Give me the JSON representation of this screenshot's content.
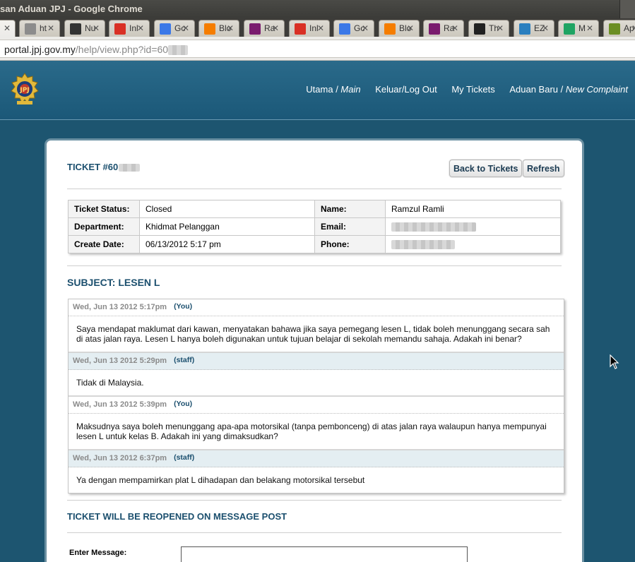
{
  "window": {
    "title": "san Aduan JPJ - Google Chrome"
  },
  "tabs": [
    {
      "label": "ht",
      "icon": "globe-icon",
      "color": "#8c8c8c"
    },
    {
      "label": "Nu",
      "icon": "github-icon",
      "color": "#333333"
    },
    {
      "label": "Inl",
      "icon": "gmail-icon",
      "color": "#d93025"
    },
    {
      "label": "Gc",
      "icon": "google-reader-icon",
      "color": "#3b78e7"
    },
    {
      "label": "Blo",
      "icon": "blogger-icon",
      "color": "#f57d00"
    },
    {
      "label": "Ra",
      "icon": "ra-icon",
      "color": "#7a1b6e"
    },
    {
      "label": "Inl",
      "icon": "gmail-icon",
      "color": "#d93025"
    },
    {
      "label": "Gc",
      "icon": "google-reader-icon",
      "color": "#3b78e7"
    },
    {
      "label": "Blo",
      "icon": "blogger-icon",
      "color": "#f57d00"
    },
    {
      "label": "Ra",
      "icon": "ra-icon",
      "color": "#7a1b6e"
    },
    {
      "label": "Th",
      "icon": "terminal-icon",
      "color": "#222222"
    },
    {
      "label": "EZ",
      "icon": "ez-icon",
      "color": "#2a7fbf"
    },
    {
      "label": "M",
      "icon": "drive-icon",
      "color": "#1fa463"
    },
    {
      "label": "Ap",
      "icon": "apps-icon",
      "color": "#6b8e23"
    }
  ],
  "address": {
    "host": "portal.jpj.gov.my",
    "path": "/help/view.php?id=60"
  },
  "nav": [
    {
      "label": "Utama / ",
      "label_em": "Main"
    },
    {
      "label": "Keluar/Log Out",
      "label_em": ""
    },
    {
      "label": "My Tickets",
      "label_em": ""
    },
    {
      "label": "Aduan Baru / ",
      "label_em": "New Complaint"
    }
  ],
  "ticket": {
    "title": "TICKET #60",
    "back_label": "Back to Tickets",
    "refresh_label": "Refresh"
  },
  "info": {
    "status_label": "Ticket Status:",
    "status_value": "Closed",
    "department_label": "Department:",
    "department_value": "Khidmat Pelanggan",
    "create_label": "Create Date:",
    "create_value": "06/13/2012 5:17 pm",
    "name_label": "Name:",
    "name_value": "Ramzul Ramli",
    "email_label": "Email:",
    "phone_label": "Phone:"
  },
  "subject": "SUBJECT: LESEN L",
  "messages": [
    {
      "date": "Wed, Jun 13 2012 5:17pm",
      "who": "(You)",
      "type": "you",
      "body": "Saya mendapat maklumat dari kawan, menyatakan bahawa jika saya pemegang lesen L, tidak boleh menunggang secara sah di atas jalan raya. Lesen L hanya boleh digunakan untuk tujuan belajar di sekolah memandu sahaja. Adakah ini benar?"
    },
    {
      "date": "Wed, Jun 13 2012 5:29pm",
      "who": "(staff)",
      "type": "staff",
      "body": "Tidak di Malaysia."
    },
    {
      "date": "Wed, Jun 13 2012 5:39pm",
      "who": "(You)",
      "type": "you",
      "body": "Maksudnya saya boleh menunggang apa-apa motorsikal (tanpa pembonceng) di atas jalan raya walaupun hanya mempunyai lesen L untuk kelas B. Adakah ini yang dimaksudkan?"
    },
    {
      "date": "Wed, Jun 13 2012 6:37pm",
      "who": "(staff)",
      "type": "staff",
      "body": "Ya dengan mempamirkan plat L dihadapan dan belakang motorsikal tersebut"
    }
  ],
  "reopen_notice": "TICKET WILL BE REOPENED ON MESSAGE POST",
  "reply": {
    "label": "Enter Message:"
  },
  "colors": {
    "header": "#1b5878",
    "heading": "#1b4f6e",
    "staff_row": "#e4eef2"
  }
}
